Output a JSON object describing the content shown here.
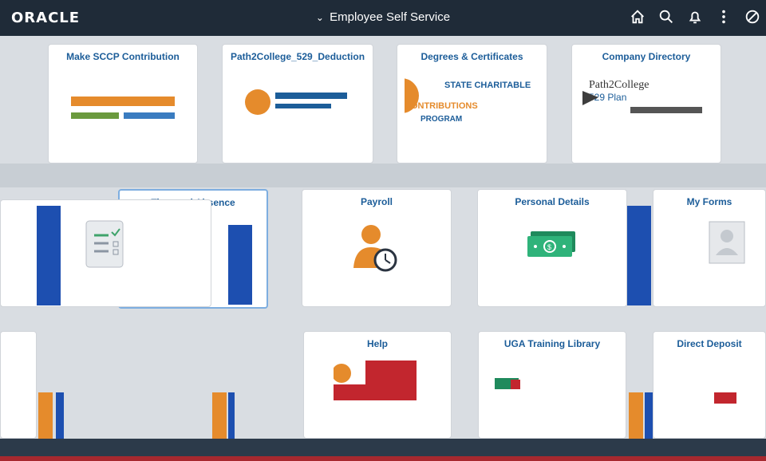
{
  "header": {
    "logo": "ORACLE",
    "title": "Employee Self Service",
    "icons": [
      "home-icon",
      "search-icon",
      "bell-icon",
      "more-icon",
      "no-entry-icon"
    ]
  },
  "tiles_row1": [
    {
      "title": "Make SCCP Contribution",
      "art": "sccp-logo"
    },
    {
      "title": "Path2College_529_Deduction",
      "art": "path2college-logo"
    },
    {
      "title": "Degrees & Certificates",
      "art": "diploma-graphic"
    },
    {
      "title": "Company Directory",
      "art": "directory-graphic"
    }
  ],
  "art_text": {
    "state_charitable": "STATE CHARITABLE",
    "contributions": "CONTRIBUTIONS",
    "program": "PROGRAM",
    "path2college": "Path2College",
    "plan529": "529 Plan"
  },
  "tiles_row2": [
    {
      "title": "Time and Absence",
      "art": "checklist-icon"
    },
    {
      "title": "Payroll",
      "art": "person-clock-icon"
    },
    {
      "title": "Personal Details",
      "art": "money-icon"
    },
    {
      "title": "My Forms",
      "art": "form-person-icon"
    }
  ],
  "tiles_row3": [
    {
      "title": "Help",
      "art": "help-graphic"
    },
    {
      "title": "UGA Training Library",
      "art": "training-graphic"
    },
    {
      "title": "Direct Deposit",
      "art": "deposit-graphic"
    }
  ],
  "colors": {
    "header_bg": "#1f2b38",
    "tile_title": "#1c5d99",
    "accent_blue": "#1d4fb0",
    "accent_orange": "#e58b2c"
  }
}
